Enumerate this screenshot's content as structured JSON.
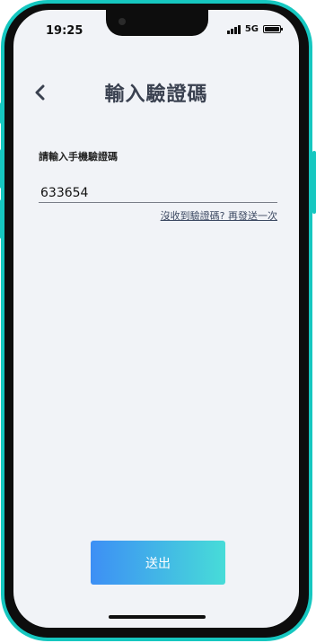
{
  "status_bar": {
    "time": "19:25",
    "network": "5G"
  },
  "header": {
    "back_icon": "chevron-left-icon",
    "title": "輸入驗證碼"
  },
  "form": {
    "label": "請輸入手機驗證碼",
    "code_value": "633654",
    "resend_link": "沒收到驗證碼? 再發送一次"
  },
  "footer": {
    "submit_label": "送出"
  },
  "colors": {
    "frame": "#16c7c0",
    "screen_bg": "#f1f3f7",
    "button_gradient_start": "#3d8ff5",
    "button_gradient_end": "#47dcd8",
    "title": "#3a4150"
  }
}
